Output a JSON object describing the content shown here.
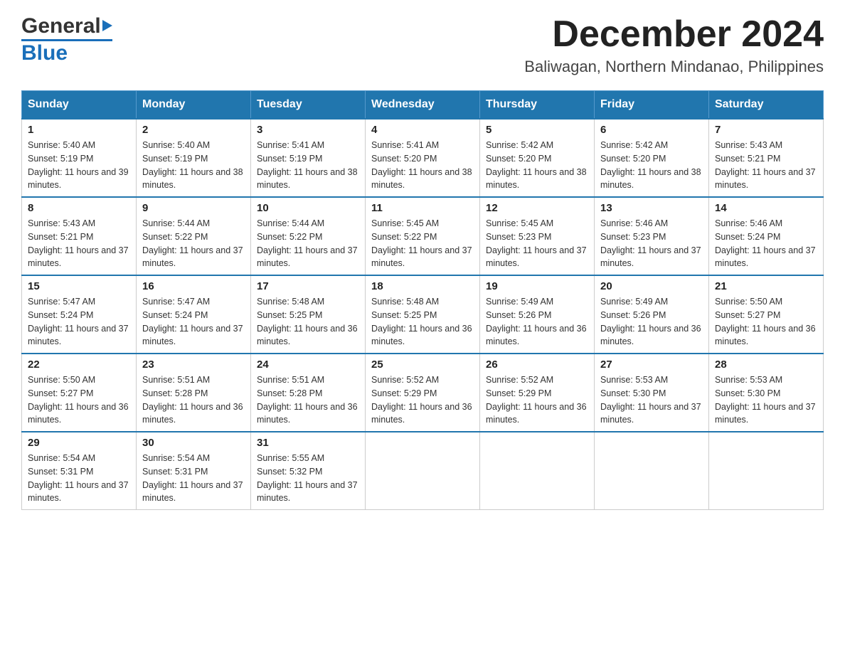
{
  "header": {
    "logo_general": "General",
    "logo_blue": "Blue",
    "main_title": "December 2024",
    "subtitle": "Baliwagan, Northern Mindanao, Philippines"
  },
  "calendar": {
    "days_of_week": [
      "Sunday",
      "Monday",
      "Tuesday",
      "Wednesday",
      "Thursday",
      "Friday",
      "Saturday"
    ],
    "weeks": [
      [
        {
          "day": "1",
          "sunrise": "5:40 AM",
          "sunset": "5:19 PM",
          "daylight": "11 hours and 39 minutes."
        },
        {
          "day": "2",
          "sunrise": "5:40 AM",
          "sunset": "5:19 PM",
          "daylight": "11 hours and 38 minutes."
        },
        {
          "day": "3",
          "sunrise": "5:41 AM",
          "sunset": "5:19 PM",
          "daylight": "11 hours and 38 minutes."
        },
        {
          "day": "4",
          "sunrise": "5:41 AM",
          "sunset": "5:20 PM",
          "daylight": "11 hours and 38 minutes."
        },
        {
          "day": "5",
          "sunrise": "5:42 AM",
          "sunset": "5:20 PM",
          "daylight": "11 hours and 38 minutes."
        },
        {
          "day": "6",
          "sunrise": "5:42 AM",
          "sunset": "5:20 PM",
          "daylight": "11 hours and 38 minutes."
        },
        {
          "day": "7",
          "sunrise": "5:43 AM",
          "sunset": "5:21 PM",
          "daylight": "11 hours and 37 minutes."
        }
      ],
      [
        {
          "day": "8",
          "sunrise": "5:43 AM",
          "sunset": "5:21 PM",
          "daylight": "11 hours and 37 minutes."
        },
        {
          "day": "9",
          "sunrise": "5:44 AM",
          "sunset": "5:22 PM",
          "daylight": "11 hours and 37 minutes."
        },
        {
          "day": "10",
          "sunrise": "5:44 AM",
          "sunset": "5:22 PM",
          "daylight": "11 hours and 37 minutes."
        },
        {
          "day": "11",
          "sunrise": "5:45 AM",
          "sunset": "5:22 PM",
          "daylight": "11 hours and 37 minutes."
        },
        {
          "day": "12",
          "sunrise": "5:45 AM",
          "sunset": "5:23 PM",
          "daylight": "11 hours and 37 minutes."
        },
        {
          "day": "13",
          "sunrise": "5:46 AM",
          "sunset": "5:23 PM",
          "daylight": "11 hours and 37 minutes."
        },
        {
          "day": "14",
          "sunrise": "5:46 AM",
          "sunset": "5:24 PM",
          "daylight": "11 hours and 37 minutes."
        }
      ],
      [
        {
          "day": "15",
          "sunrise": "5:47 AM",
          "sunset": "5:24 PM",
          "daylight": "11 hours and 37 minutes."
        },
        {
          "day": "16",
          "sunrise": "5:47 AM",
          "sunset": "5:24 PM",
          "daylight": "11 hours and 37 minutes."
        },
        {
          "day": "17",
          "sunrise": "5:48 AM",
          "sunset": "5:25 PM",
          "daylight": "11 hours and 36 minutes."
        },
        {
          "day": "18",
          "sunrise": "5:48 AM",
          "sunset": "5:25 PM",
          "daylight": "11 hours and 36 minutes."
        },
        {
          "day": "19",
          "sunrise": "5:49 AM",
          "sunset": "5:26 PM",
          "daylight": "11 hours and 36 minutes."
        },
        {
          "day": "20",
          "sunrise": "5:49 AM",
          "sunset": "5:26 PM",
          "daylight": "11 hours and 36 minutes."
        },
        {
          "day": "21",
          "sunrise": "5:50 AM",
          "sunset": "5:27 PM",
          "daylight": "11 hours and 36 minutes."
        }
      ],
      [
        {
          "day": "22",
          "sunrise": "5:50 AM",
          "sunset": "5:27 PM",
          "daylight": "11 hours and 36 minutes."
        },
        {
          "day": "23",
          "sunrise": "5:51 AM",
          "sunset": "5:28 PM",
          "daylight": "11 hours and 36 minutes."
        },
        {
          "day": "24",
          "sunrise": "5:51 AM",
          "sunset": "5:28 PM",
          "daylight": "11 hours and 36 minutes."
        },
        {
          "day": "25",
          "sunrise": "5:52 AM",
          "sunset": "5:29 PM",
          "daylight": "11 hours and 36 minutes."
        },
        {
          "day": "26",
          "sunrise": "5:52 AM",
          "sunset": "5:29 PM",
          "daylight": "11 hours and 36 minutes."
        },
        {
          "day": "27",
          "sunrise": "5:53 AM",
          "sunset": "5:30 PM",
          "daylight": "11 hours and 37 minutes."
        },
        {
          "day": "28",
          "sunrise": "5:53 AM",
          "sunset": "5:30 PM",
          "daylight": "11 hours and 37 minutes."
        }
      ],
      [
        {
          "day": "29",
          "sunrise": "5:54 AM",
          "sunset": "5:31 PM",
          "daylight": "11 hours and 37 minutes."
        },
        {
          "day": "30",
          "sunrise": "5:54 AM",
          "sunset": "5:31 PM",
          "daylight": "11 hours and 37 minutes."
        },
        {
          "day": "31",
          "sunrise": "5:55 AM",
          "sunset": "5:32 PM",
          "daylight": "11 hours and 37 minutes."
        },
        null,
        null,
        null,
        null
      ]
    ]
  }
}
